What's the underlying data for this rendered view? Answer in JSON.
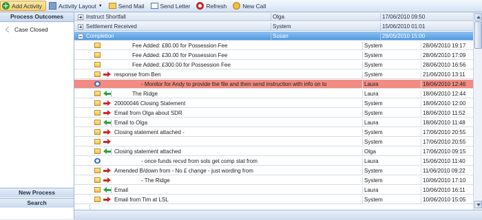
{
  "toolbar": {
    "buttons": [
      {
        "label": "Add Activity",
        "icon": "add-icon"
      },
      {
        "label": "Activity Layout",
        "icon": "layout-icon",
        "dropdown": true
      },
      {
        "label": "Send Mail",
        "icon": "mail-icon"
      },
      {
        "label": "Send Letter",
        "icon": "letter-icon"
      },
      {
        "label": "Refresh",
        "icon": "refresh-icon"
      },
      {
        "label": "New Call",
        "icon": "phone-icon"
      }
    ]
  },
  "left_panel": {
    "header": "Process Outcomes",
    "items": [
      "Case Closed"
    ],
    "footer_buttons": [
      "New Process",
      "Search"
    ]
  },
  "groups": [
    {
      "title": "Instruct Shortfall",
      "user": "Olga",
      "date": "17/06/2010 09:50",
      "expanded": false,
      "selected": false
    },
    {
      "title": "Settlement Received",
      "user": "System",
      "date": "15/06/2010 01:01",
      "expanded": false,
      "selected": false
    },
    {
      "title": "Completion",
      "user": "Susan",
      "date": "28/05/2010 15:00",
      "expanded": true,
      "selected": true
    }
  ],
  "activities": [
    {
      "icon": "note",
      "arrow": "",
      "text": "Fee Added: £80.00 for Possession Fee",
      "indent": 2,
      "user": "System",
      "date": "28/06/2010 19:17"
    },
    {
      "icon": "note",
      "arrow": "",
      "text": "Fee Added: £30.00 for Possession Fee",
      "indent": 2,
      "user": "System",
      "date": "28/06/2010 17:09"
    },
    {
      "icon": "note",
      "arrow": "",
      "text": "Fee Added: £300.00 for Possession Fee",
      "indent": 2,
      "user": "System",
      "date": "28/06/2010 16:56"
    },
    {
      "icon": "note",
      "arrow": "right",
      "text": "response from Ben",
      "indent": 0,
      "user": "System",
      "date": "21/06/2010 13:11"
    },
    {
      "icon": "clock",
      "arrow": "",
      "text": "- Monitor for Andy to provide the file and then send instruction with info on to",
      "indent": 3,
      "user": "Laura",
      "date": "18/06/2010 12:46",
      "highlight": true
    },
    {
      "icon": "note",
      "arrow": "left",
      "text": "The Ridge",
      "indent": 2,
      "user": "Laura",
      "date": "18/06/2010 12:44"
    },
    {
      "icon": "note",
      "arrow": "right",
      "text": "20000046 Closing Statement",
      "indent": 0,
      "user": "System",
      "date": "18/06/2010 12:00"
    },
    {
      "icon": "note",
      "arrow": "right",
      "text": "Email from Olga about SDR",
      "indent": 0,
      "user": "System",
      "date": "18/06/2010 11:52"
    },
    {
      "icon": "note",
      "arrow": "left",
      "text": "Email to Olga",
      "indent": 0,
      "user": "Laura",
      "date": "18/06/2010 11:48"
    },
    {
      "icon": "note",
      "arrow": "right",
      "text": "Closing statement attached -",
      "indent": 0,
      "user": "System",
      "date": "17/06/2010 20:55"
    },
    {
      "icon": "note",
      "arrow": "right",
      "text": "",
      "indent": 0,
      "user": "System",
      "date": "17/06/2010 20:55"
    },
    {
      "icon": "note",
      "arrow": "left",
      "text": "Closing statement attached",
      "indent": 0,
      "user": "Olga",
      "date": "17/06/2010 09:15"
    },
    {
      "icon": "clock",
      "arrow": "",
      "text": "- once funds recvd from sols get comp stat from",
      "indent": 3,
      "user": "Laura",
      "date": "15/06/2010 11:40"
    },
    {
      "icon": "note",
      "arrow": "right",
      "text": "Amended B/down from        - No £ change - just wording from",
      "indent": 0,
      "user": "System",
      "date": "11/06/2010 09:22"
    },
    {
      "icon": "note",
      "arrow": "right",
      "text": "- The Ridge",
      "indent": 3,
      "user": "System",
      "date": "10/06/2010 17:10"
    },
    {
      "icon": "note",
      "arrow": "left",
      "text": "Email",
      "indent": 0,
      "user": "Laura",
      "date": "10/06/2010 16:11"
    },
    {
      "icon": "note",
      "arrow": "right",
      "text": "Email from Tim at LSL",
      "indent": 0,
      "user": "System",
      "date": "10/06/2010 15:05"
    }
  ],
  "colors": {
    "selected_row": "#4e9ae3",
    "alert_row": "#f28b82",
    "toolbar_active": "#f6cf6b"
  }
}
